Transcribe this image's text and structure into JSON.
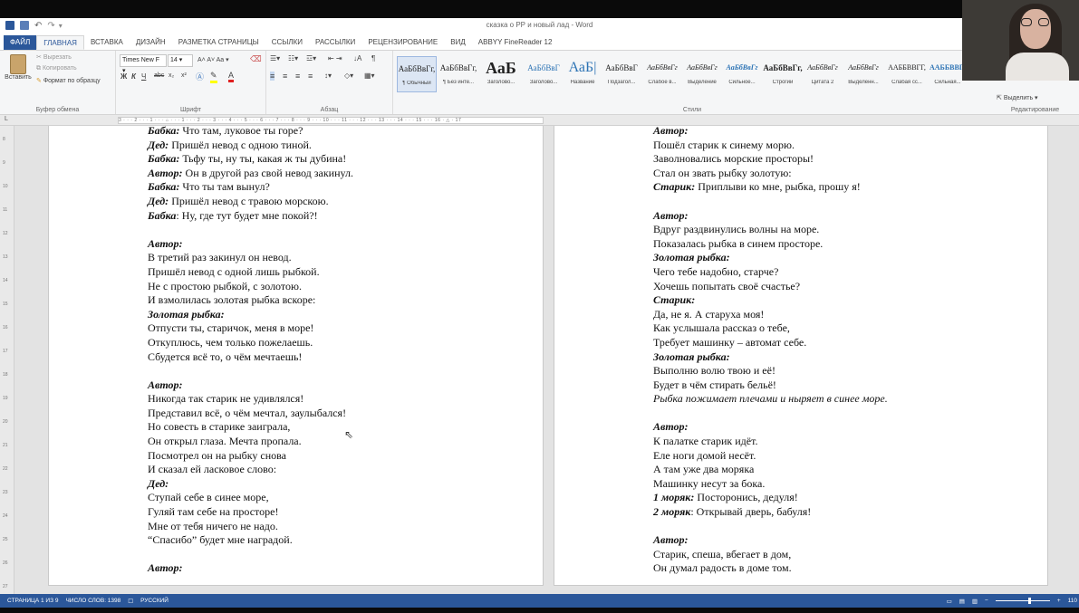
{
  "window": {
    "title": "сказка о РР и новый лад - Word"
  },
  "tabs": [
    "ФАЙЛ",
    "ГЛАВНАЯ",
    "ВСТАВКА",
    "ДИЗАЙН",
    "РАЗМЕТКА СТРАНИЦЫ",
    "ССЫЛКИ",
    "РАССЫЛКИ",
    "РЕЦЕНЗИРОВАНИЕ",
    "ВИД",
    "ABBYY FineReader 12"
  ],
  "ribbon": {
    "clipboard": {
      "paste": "Вставить",
      "cut": "Вырезать",
      "copy": "Копировать",
      "format_painter": "Формат по образцу",
      "label": "Буфер обмена"
    },
    "font": {
      "name": "Times New F",
      "size": "14",
      "label": "Шрифт",
      "bold": "Ж",
      "italic": "К",
      "underline": "Ч",
      "strike": "abc",
      "sub": "x₂",
      "sup": "x²"
    },
    "paragraph": {
      "label": "Абзац"
    },
    "styles": {
      "label": "Стили",
      "items": [
        {
          "sample": "АаБбВвГг,",
          "name": "¶ Обычный"
        },
        {
          "sample": "АаБбВвГг,",
          "name": "¶ Без инте..."
        },
        {
          "sample": "АаБ",
          "name": "Заголово..."
        },
        {
          "sample": "АаБбВвГ",
          "name": "Заголово..."
        },
        {
          "sample": "АаБ|",
          "name": "Название"
        },
        {
          "sample": "АаБбВвГ",
          "name": "Подзагол..."
        },
        {
          "sample": "АаБбВвГг",
          "name": "Слабое в..."
        },
        {
          "sample": "АаБбВвГг",
          "name": "Выделение"
        },
        {
          "sample": "АаБбВвГг",
          "name": "Сильное..."
        },
        {
          "sample": "АаБбВвГг,",
          "name": "Строгий"
        },
        {
          "sample": "АаБбВвГг",
          "name": "Цитата 2"
        },
        {
          "sample": "АаБбВвГг",
          "name": "Выделенн..."
        },
        {
          "sample": "ААББВВГГ,",
          "name": "Слабая сс..."
        },
        {
          "sample": "ААББВВГГ",
          "name": "Сильная..."
        }
      ]
    },
    "editing": {
      "select": "Выделить",
      "label": "Редактирование"
    }
  },
  "ruler": {
    "h": "3 · · · 2 · · · 1 · · · ⌂ · · · 1 · · · 2 · · · 3 · · · 4 · · · 5 · · · 6 · · · 7 · · · 8 · · · 9 · · · 10 · · · 11 · · · 12 · · · 13 · · · 14 · · · 15 · · · 16 · △ · 17",
    "v": [
      "8",
      "9",
      "10",
      "11",
      "12",
      "13",
      "14",
      "15",
      "16",
      "17",
      "18",
      "19",
      "20",
      "21",
      "22",
      "23",
      "24",
      "25",
      "26",
      "27"
    ]
  },
  "page_left": [
    {
      "runs": [
        {
          "t": "Бабка:",
          "s": "b"
        },
        {
          "t": " Что там, луковое ты горе?",
          "s": ""
        }
      ]
    },
    {
      "runs": [
        {
          "t": "Дед:",
          "s": "b"
        },
        {
          "t": " Пришёл невод с одною тиной.",
          "s": ""
        }
      ]
    },
    {
      "runs": [
        {
          "t": "Бабка:",
          "s": "b"
        },
        {
          "t": " Тьфу ты, ну ты, какая ж ты дубина!",
          "s": ""
        }
      ]
    },
    {
      "runs": [
        {
          "t": "Автор:",
          "s": "b"
        },
        {
          "t": " Он в другой раз свой невод закинул.",
          "s": ""
        }
      ]
    },
    {
      "runs": [
        {
          "t": "Бабка:",
          "s": "b"
        },
        {
          "t": " Что ты там вынул?",
          "s": ""
        }
      ]
    },
    {
      "runs": [
        {
          "t": "Дед:",
          "s": "b"
        },
        {
          "t": " Пришёл невод с травою морскою.",
          "s": ""
        }
      ]
    },
    {
      "runs": [
        {
          "t": "Бабка",
          "s": "b"
        },
        {
          "t": ": Ну, где тут будет мне покой?!",
          "s": ""
        }
      ]
    },
    {
      "runs": []
    },
    {
      "runs": [
        {
          "t": "Автор:",
          "s": "b"
        }
      ]
    },
    {
      "runs": [
        {
          "t": "В третий раз закинул он невод.",
          "s": ""
        }
      ]
    },
    {
      "runs": [
        {
          "t": "Пришёл невод с одной лишь рыбкой.",
          "s": ""
        }
      ]
    },
    {
      "runs": [
        {
          "t": "Не с простою рыбкой, с золотою.",
          "s": ""
        }
      ]
    },
    {
      "runs": [
        {
          "t": "И взмолилась золотая рыбка вскоре:",
          "s": ""
        }
      ]
    },
    {
      "runs": [
        {
          "t": "Золотая рыбка:",
          "s": "b"
        }
      ]
    },
    {
      "runs": [
        {
          "t": "Отпусти ты, старичок, меня в море!",
          "s": ""
        }
      ]
    },
    {
      "runs": [
        {
          "t": "Откуплюсь, чем только пожелаешь.",
          "s": ""
        }
      ]
    },
    {
      "runs": [
        {
          "t": "Сбудется всё то, о чём мечтаешь!",
          "s": ""
        }
      ]
    },
    {
      "runs": []
    },
    {
      "runs": [
        {
          "t": "Автор:",
          "s": "b"
        }
      ]
    },
    {
      "runs": [
        {
          "t": "Никогда так старик не удивлялся!",
          "s": ""
        }
      ]
    },
    {
      "runs": [
        {
          "t": "Представил всё, о чём мечтал, заулыбался!",
          "s": ""
        }
      ]
    },
    {
      "runs": [
        {
          "t": "Но совесть в старике заиграла,",
          "s": ""
        }
      ]
    },
    {
      "runs": [
        {
          "t": "Он открыл глаза. Мечта пропала.",
          "s": ""
        }
      ]
    },
    {
      "runs": [
        {
          "t": "Посмотрел он на рыбку снова",
          "s": ""
        }
      ]
    },
    {
      "runs": [
        {
          "t": "И сказал ей ласковое слово:",
          "s": ""
        }
      ]
    },
    {
      "runs": [
        {
          "t": "Дед:",
          "s": "b"
        }
      ]
    },
    {
      "runs": [
        {
          "t": "Ступай себе в синее море,",
          "s": ""
        }
      ]
    },
    {
      "runs": [
        {
          "t": "Гуляй там себе на просторе!",
          "s": ""
        }
      ]
    },
    {
      "runs": [
        {
          "t": "Мне от тебя ничего не надо.",
          "s": ""
        }
      ]
    },
    {
      "runs": [
        {
          "t": "“Спасибо” будет мне наградой.",
          "s": ""
        }
      ]
    },
    {
      "runs": []
    },
    {
      "runs": [
        {
          "t": "Автор:",
          "s": "b"
        }
      ]
    }
  ],
  "page_right": [
    {
      "runs": [
        {
          "t": "Автор:",
          "s": "b"
        }
      ]
    },
    {
      "runs": [
        {
          "t": "Пошёл старик к синему морю.",
          "s": ""
        }
      ]
    },
    {
      "runs": [
        {
          "t": "Заволновались морские просторы!",
          "s": ""
        }
      ]
    },
    {
      "runs": [
        {
          "t": "Стал он звать рыбку золотую:",
          "s": ""
        }
      ]
    },
    {
      "runs": [
        {
          "t": "Старик:",
          "s": "b"
        },
        {
          "t": " Приплыви ко мне, рыбка, прошу я!",
          "s": ""
        }
      ]
    },
    {
      "runs": []
    },
    {
      "runs": [
        {
          "t": "Автор:",
          "s": "b"
        }
      ]
    },
    {
      "runs": [
        {
          "t": "Вдруг раздвинулись волны на море.",
          "s": ""
        }
      ]
    },
    {
      "runs": [
        {
          "t": "Показалась рыбка в синем просторе.",
          "s": ""
        }
      ]
    },
    {
      "runs": [
        {
          "t": "Золотая рыбка:",
          "s": "b"
        }
      ]
    },
    {
      "runs": [
        {
          "t": "Чего тебе надобно, старче?",
          "s": ""
        }
      ]
    },
    {
      "runs": [
        {
          "t": "Хочешь попытать своё счастье?",
          "s": ""
        }
      ]
    },
    {
      "runs": [
        {
          "t": "Старик:",
          "s": "b"
        }
      ]
    },
    {
      "runs": [
        {
          "t": "Да, не я. А старуха моя!",
          "s": ""
        }
      ]
    },
    {
      "runs": [
        {
          "t": "Как услышала рассказ о тебе,",
          "s": ""
        }
      ]
    },
    {
      "runs": [
        {
          "t": "Требует машинку – автомат себе.",
          "s": ""
        }
      ]
    },
    {
      "runs": [
        {
          "t": "Золотая рыбка:",
          "s": "b"
        }
      ]
    },
    {
      "runs": [
        {
          "t": "Выполню волю твою и её!",
          "s": ""
        }
      ]
    },
    {
      "runs": [
        {
          "t": "Будет в чём стирать бельё!",
          "s": ""
        }
      ]
    },
    {
      "runs": [
        {
          "t": "Рыбка пожимает плечами и ныряет в синее море.",
          "s": "i"
        }
      ]
    },
    {
      "runs": []
    },
    {
      "runs": [
        {
          "t": "Автор:",
          "s": "b"
        }
      ]
    },
    {
      "runs": [
        {
          "t": "К палатке старик идёт.",
          "s": ""
        }
      ]
    },
    {
      "runs": [
        {
          "t": "Еле ноги домой несёт.",
          "s": ""
        }
      ]
    },
    {
      "runs": [
        {
          "t": "А там уже два моряка",
          "s": ""
        }
      ]
    },
    {
      "runs": [
        {
          "t": "Машинку несут за бока.",
          "s": ""
        }
      ]
    },
    {
      "runs": [
        {
          "t": "1 моряк:",
          "s": "b"
        },
        {
          "t": " Посторонись, дедуля!",
          "s": ""
        }
      ]
    },
    {
      "runs": [
        {
          "t": "2 моряк",
          "s": "b"
        },
        {
          "t": ": Открывай дверь, бабуля!",
          "s": ""
        }
      ]
    },
    {
      "runs": []
    },
    {
      "runs": [
        {
          "t": "Автор:",
          "s": "b"
        }
      ]
    },
    {
      "runs": [
        {
          "t": "Старик, спеша, вбегает в дом,",
          "s": ""
        }
      ]
    },
    {
      "runs": [
        {
          "t": "Он думал радость в доме том.",
          "s": ""
        }
      ]
    }
  ],
  "status": {
    "page": "СТРАНИЦА 1 ИЗ 9",
    "words": "ЧИСЛО СЛОВ: 1398",
    "lang": "РУССКИЙ",
    "zoom": "110"
  },
  "colors": {
    "accent": "#2b579a",
    "ribbon_bg": "#f5f6f7",
    "doc_bg": "#e3e3e3"
  },
  "icons": {
    "save": "save-icon",
    "undo": "undo-icon",
    "redo": "redo-icon",
    "paste": "paste-icon",
    "cut": "scissors-icon",
    "copy": "copy-icon",
    "brush": "format-painter-icon"
  }
}
